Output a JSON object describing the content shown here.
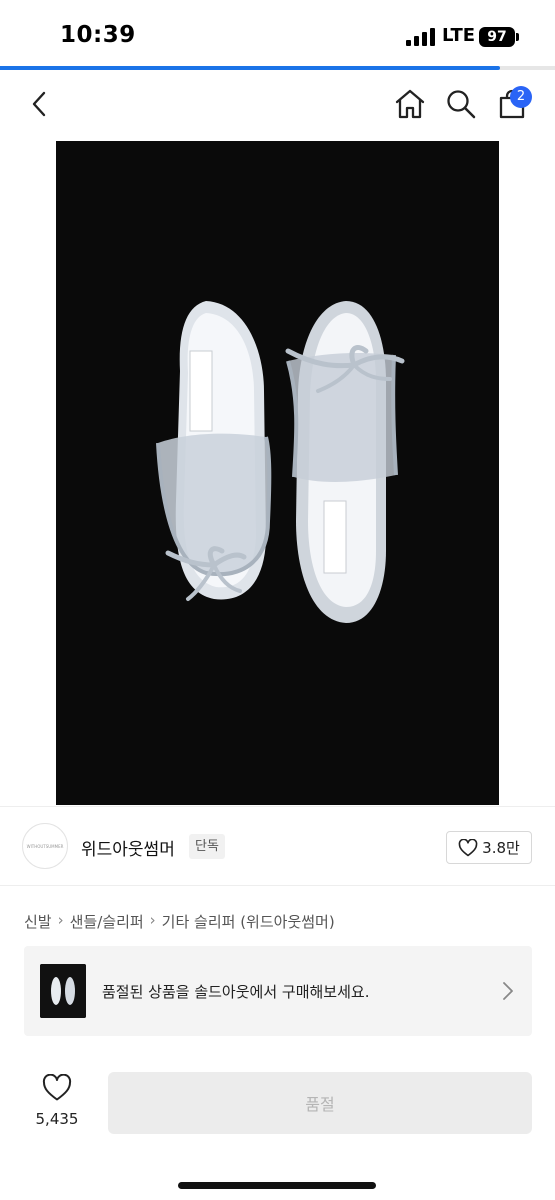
{
  "status_bar": {
    "time": "10:39",
    "network": "LTE",
    "battery": "97"
  },
  "page_progress": 0.9,
  "header": {
    "icons": [
      "back-icon",
      "home-icon",
      "search-icon",
      "shopping-bag-icon"
    ],
    "cart_count": "2"
  },
  "product_image": {
    "background": "#0a0a0a",
    "subject": "silver bow sandals"
  },
  "seller": {
    "name": "위드아웃썸머",
    "badge": "단독",
    "likes": "3.8만",
    "logo_text": "WITHOUTSUMMER"
  },
  "breadcrumb": [
    "신발",
    "샌들/슬리퍼",
    "기타 슬리퍼 (위드아웃썸머)"
  ],
  "soldout_banner": {
    "text": "품절된 상품을 솔드아웃에서 구매해보세요."
  },
  "bottom_bar": {
    "wish_count": "5,435",
    "buy_label": "품절"
  },
  "colors": {
    "accent": "#2a64f6",
    "progress": "#1a73e8",
    "disabled_button": "#ececec"
  }
}
